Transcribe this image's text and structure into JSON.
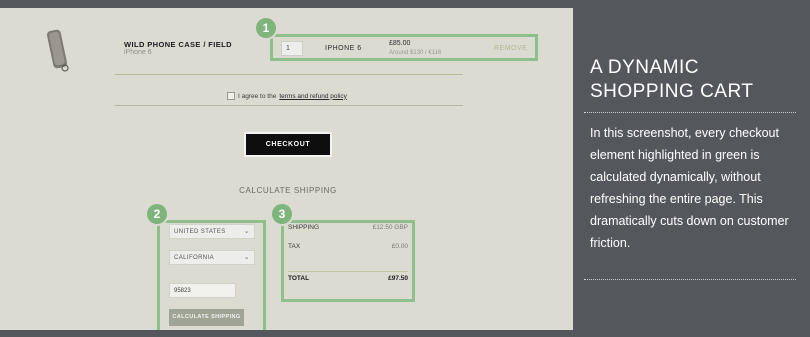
{
  "cart_item": {
    "name": "WILD PHONE CASE / FIELD",
    "variant": "iPhone 6",
    "quantity": "1",
    "model": "IPHONE 6",
    "price": "£85.00",
    "conversion": "Around $130 / €116",
    "remove_label": "REMOVE"
  },
  "agreement": {
    "prefix": "I agree to the",
    "link": "terms and refund policy"
  },
  "checkout_label": "CHECKOUT",
  "shipping": {
    "heading": "CALCULATE SHIPPING",
    "country": "UNITED STATES",
    "state": "CALIFORNIA",
    "zip": "95823",
    "button_label": "CALCULATE SHIPPING"
  },
  "summary": {
    "shipping_label": "SHIPPING",
    "shipping_value": "£12.50 GBP",
    "tax_label": "TAX",
    "tax_value": "£0.00",
    "total_label": "TOTAL",
    "total_value": "£97.50"
  },
  "badges": [
    "1",
    "2",
    "3"
  ],
  "highlight_color": "#8dc08a",
  "sidebar": {
    "title_line1": "A DYNAMIC",
    "title_line2": "SHOPPING CART",
    "text": "In this screenshot, every checkout element highlighted in green is calculated dynamically, without refreshing the entire page. This dramatically cuts down on customer friction."
  }
}
